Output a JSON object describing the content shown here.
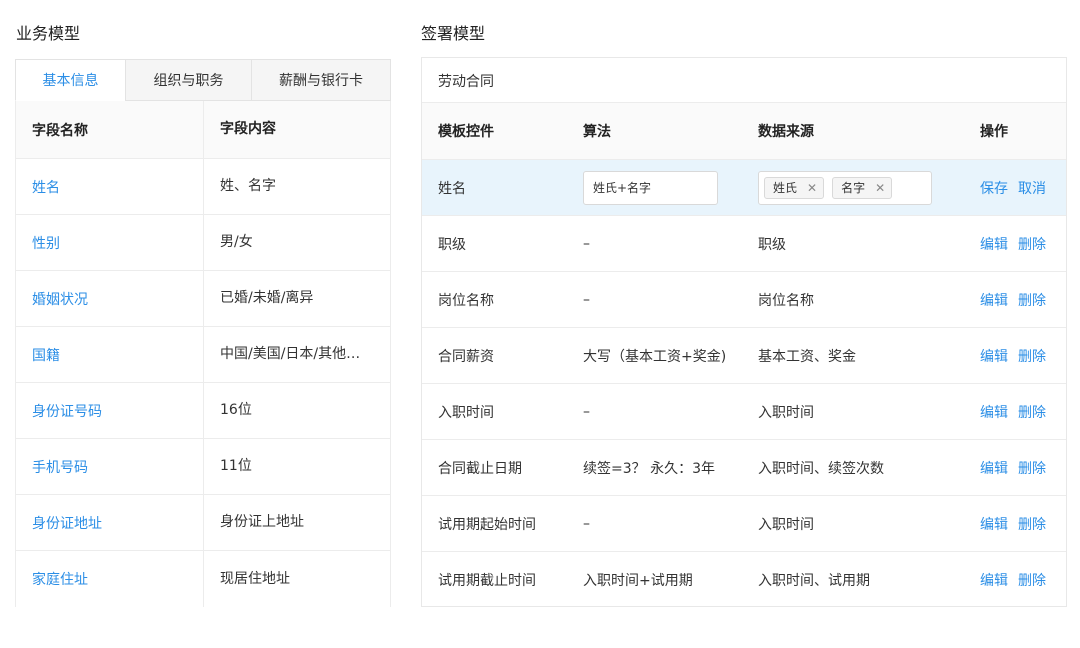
{
  "left": {
    "title": "业务模型",
    "tabs": [
      "基本信息",
      "组织与职务",
      "薪酬与银行卡"
    ],
    "header": [
      "字段名称",
      "字段内容"
    ],
    "rows": [
      [
        "姓名",
        "姓、名字"
      ],
      [
        "性别",
        "男/女"
      ],
      [
        "婚姻状况",
        "已婚/未婚/离异"
      ],
      [
        "国籍",
        "中国/美国/日本/其他…"
      ],
      [
        "身份证号码",
        "16位"
      ],
      [
        "手机号码",
        "11位"
      ],
      [
        "身份证地址",
        "身份证上地址"
      ],
      [
        "家庭住址",
        "现居住地址"
      ]
    ]
  },
  "right": {
    "title": "签署模型",
    "panel_title": "劳动合同",
    "header": [
      "模板控件",
      "算法",
      "数据来源",
      "操作"
    ],
    "editing_row": {
      "control": "姓名",
      "algorithm_value": "姓氏+名字",
      "tags": [
        "姓氏",
        "名字"
      ],
      "save": "保存",
      "cancel": "取消"
    },
    "rows": [
      [
        "职级",
        "–",
        "职级"
      ],
      [
        "岗位名称",
        "–",
        "岗位名称"
      ],
      [
        "合同薪资",
        "大写（基本工资+奖金)",
        "基本工资、奖金"
      ],
      [
        "入职时间",
        "–",
        "入职时间"
      ],
      [
        "合同截止日期",
        "续签=3？ 永久：3年",
        "入职时间、续签次数"
      ],
      [
        "试用期起始时间",
        "–",
        "入职时间"
      ],
      [
        "试用期截止时间",
        "入职时间+试用期",
        "入职时间、试用期"
      ]
    ],
    "edit_label": "编辑",
    "delete_label": "删除"
  },
  "colors": {
    "accent": "#2b8ee6",
    "editing_row_bg": "#e8f4fc"
  }
}
